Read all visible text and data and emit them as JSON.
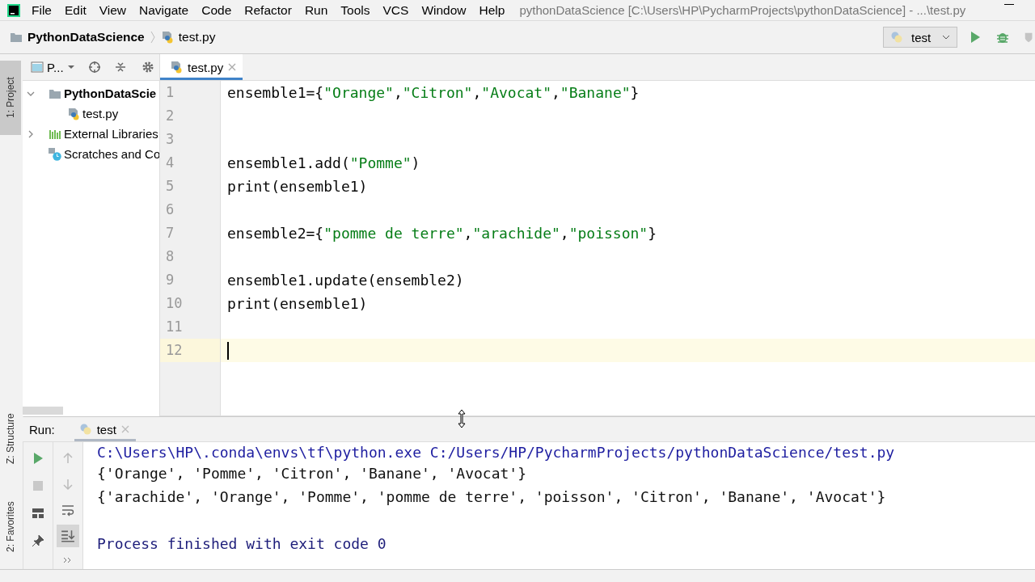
{
  "menu": [
    "File",
    "Edit",
    "View",
    "Navigate",
    "Code",
    "Refactor",
    "Run",
    "Tools",
    "VCS",
    "Window",
    "Help"
  ],
  "window": {
    "title": "pythonDataScience [C:\\Users\\HP\\PycharmProjects\\pythonDataScience] - ...\\test.py"
  },
  "breadcrumbs": [
    "PythonDataScience",
    "test.py"
  ],
  "run_config": {
    "label": "test"
  },
  "tool_stripe": [
    {
      "label": "1: Project",
      "selected": true
    },
    {
      "label": "Z: Structure",
      "selected": false
    },
    {
      "label": "2: Favorites",
      "selected": false
    }
  ],
  "project_panel": {
    "view": "P...",
    "tree": [
      {
        "label": "PythonDataScie",
        "kind": "folder",
        "expanded": true,
        "children": [
          {
            "label": "test.py",
            "kind": "file"
          }
        ]
      },
      {
        "label": "External Libraries",
        "kind": "library",
        "expanded": false
      },
      {
        "label": "Scratches and Co",
        "kind": "scratch"
      }
    ]
  },
  "editor": {
    "tabs": [
      {
        "label": "test.py",
        "selected": true
      }
    ],
    "lines": [
      {
        "number": "1",
        "current": false,
        "tokens": [
          {
            "kind": "plain",
            "text": "ensemble1={"
          },
          {
            "kind": "string",
            "text": "\"Orange\""
          },
          {
            "kind": "plain",
            "text": ","
          },
          {
            "kind": "string",
            "text": "\"Citron\""
          },
          {
            "kind": "plain",
            "text": ","
          },
          {
            "kind": "string",
            "text": "\"Avocat\""
          },
          {
            "kind": "plain",
            "text": ","
          },
          {
            "kind": "string",
            "text": "\"Banane\""
          },
          {
            "kind": "plain",
            "text": "}"
          }
        ]
      },
      {
        "number": "2",
        "current": false
      },
      {
        "number": "3",
        "current": false
      },
      {
        "number": "4",
        "current": false,
        "tokens": [
          {
            "kind": "plain",
            "text": "ensemble1.add("
          },
          {
            "kind": "string",
            "text": "\"Pomme\""
          },
          {
            "kind": "plain",
            "text": ")"
          }
        ]
      },
      {
        "number": "5",
        "current": false,
        "tokens": [
          {
            "kind": "plain",
            "text": "print(ensemble1)"
          }
        ]
      },
      {
        "number": "6",
        "current": false
      },
      {
        "number": "7",
        "current": false,
        "tokens": [
          {
            "kind": "plain",
            "text": "ensemble2={"
          },
          {
            "kind": "string",
            "text": "\"pomme de terre\""
          },
          {
            "kind": "plain",
            "text": ","
          },
          {
            "kind": "string",
            "text": "\"arachide\""
          },
          {
            "kind": "plain",
            "text": ","
          },
          {
            "kind": "string",
            "text": "\"poisson\""
          },
          {
            "kind": "plain",
            "text": "}"
          }
        ]
      },
      {
        "number": "8",
        "current": false
      },
      {
        "number": "9",
        "current": false,
        "tokens": [
          {
            "kind": "plain",
            "text": "ensemble1.update(ensemble2)"
          }
        ]
      },
      {
        "number": "10",
        "current": false,
        "tokens": [
          {
            "kind": "plain",
            "text": "print(ensemble1)"
          }
        ]
      },
      {
        "number": "11",
        "current": false
      },
      {
        "number": "12",
        "current": true
      }
    ]
  },
  "run_panel": {
    "title": "Run:",
    "tabs": [
      {
        "label": "test",
        "selected": true
      }
    ],
    "output": [
      {
        "kind": "command",
        "text": "C:\\Users\\HP\\.conda\\envs\\tf\\python.exe C:/Users/HP/PycharmProjects/pythonDataScience/test.py"
      },
      {
        "kind": "stdout",
        "text": "{'Orange', 'Pomme', 'Citron', 'Banane', 'Avocat'}"
      },
      {
        "kind": "stdout",
        "text": "{'arachide', 'Orange', 'Pomme', 'pomme de terre', 'poisson', 'Citron', 'Banane', 'Avocat'}"
      },
      {
        "kind": "blank"
      },
      {
        "kind": "system",
        "text": "Process finished with exit code 0"
      }
    ]
  }
}
